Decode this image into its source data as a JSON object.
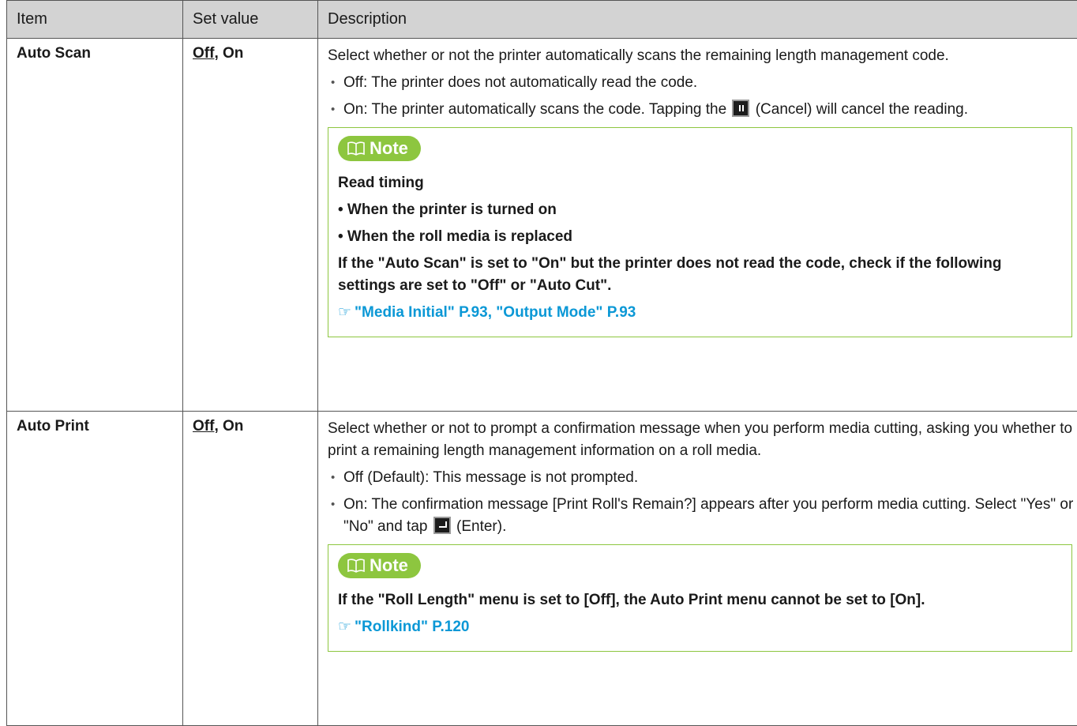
{
  "headers": {
    "item": "Item",
    "set_value": "Set value",
    "description": "Description"
  },
  "rows": [
    {
      "item": "Auto Scan",
      "set_default": "Off",
      "set_rest": ", On",
      "desc": "Select whether or not the printer automatically scans the remaining length management code.",
      "bullet1": "Off: The printer does not automatically read the code.",
      "bullet2_pre": "On: The printer automatically scans the code. Tapping the",
      "bullet2_post": "(Cancel) will cancel the reading.",
      "note_label": "Note",
      "note_lines": [
        "Read timing",
        "• When the printer is turned on",
        "• When the roll media is replaced",
        "If the \"Auto Scan\" is set to \"On\" but the printer does not read the code, check if the following settings are set to \"Off\" or \"Auto Cut\"."
      ],
      "note_ref": "\"Media Initial\" P.93, \"Output Mode\" P.93"
    },
    {
      "item": "Auto Print",
      "set_default": "Off",
      "set_rest": ", On",
      "desc": "Select whether or not to prompt a confirmation message when you perform media cutting, asking you whether to print a remaining length management information on a roll media.",
      "bullet1": "Off (Default): This message is not prompted.",
      "bullet2_pre": "On: The confirmation message [Print Roll's Remain?] appears after you perform media cutting. Select \"Yes\" or \"No\" and tap",
      "bullet2_post": "(Enter).",
      "note_label": "Note",
      "note_lines": [
        "If the \"Roll Length\" menu is set to [Off], the Auto Print menu cannot be set to [On]."
      ],
      "note_ref": "\"Rollkind\" P.120"
    }
  ],
  "colors": {
    "header_bg": "#d3d3d3",
    "note_green": "#8dc63f",
    "link_blue": "#0b98d6"
  }
}
